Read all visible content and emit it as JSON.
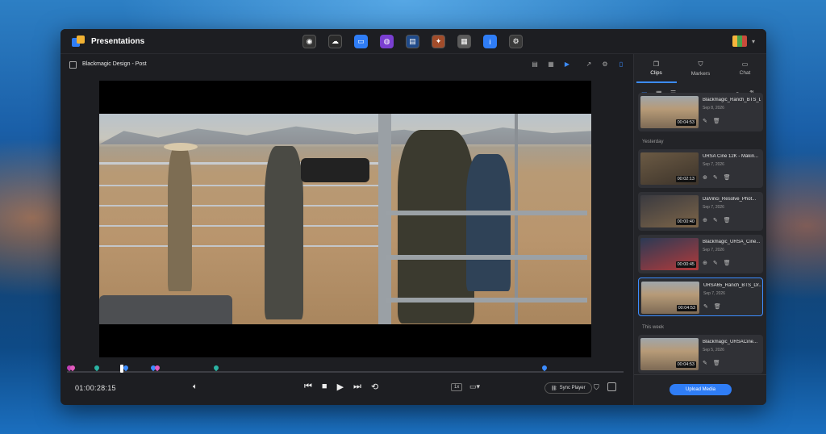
{
  "app": {
    "title": "Presentations"
  },
  "toolbar_apps": [
    "davinci-resolve-icon",
    "cloud-users-icon",
    "proxy-icon",
    "presentations-icon",
    "media-icon",
    "speed-editor-icon",
    "hdmi-monitor-icon",
    "info-icon",
    "settings-icon"
  ],
  "project": {
    "title": "Blackmagic Design - Post"
  },
  "player": {
    "timecode": "01:00:28:15",
    "speed": "1x",
    "sync_label": "Sync Player"
  },
  "marker_colors": [
    "#c33fb6",
    "#2bb3a3",
    "#3c8cff",
    "#e25bbd"
  ],
  "tabs": [
    {
      "label": "Clips",
      "icon": "clips-icon",
      "active": true
    },
    {
      "label": "Markers",
      "icon": "markers-icon"
    },
    {
      "label": "Chat",
      "icon": "chat-icon"
    }
  ],
  "groups": {
    "yesterday": "Yesterday",
    "this_week": "This week"
  },
  "clips": [
    {
      "name": "Blackmagic_Ranch_BTS_Dr...",
      "date": "Sep 8, 2026",
      "duration": "00:04:53"
    },
    {
      "name": "URSA Cine 12K - Makin...",
      "date": "Sep 7, 2026",
      "duration": "00:02:13"
    },
    {
      "name": "DaVinci_Resolve_Phot...",
      "date": "Sep 7, 2026",
      "duration": "00:00:40"
    },
    {
      "name": "Blackmagic_URSA_Cine...",
      "date": "Sep 7, 2026",
      "duration": "00:00:45"
    },
    {
      "name": "URSA65_Ranch_BTS_Dr...",
      "date": "Sep 7, 2026",
      "duration": "00:04:53"
    },
    {
      "name": "Blackmagic_URSACine...",
      "date": "Sep 5, 2026",
      "duration": "00:04:53"
    }
  ],
  "upload_label": "Upload Media"
}
